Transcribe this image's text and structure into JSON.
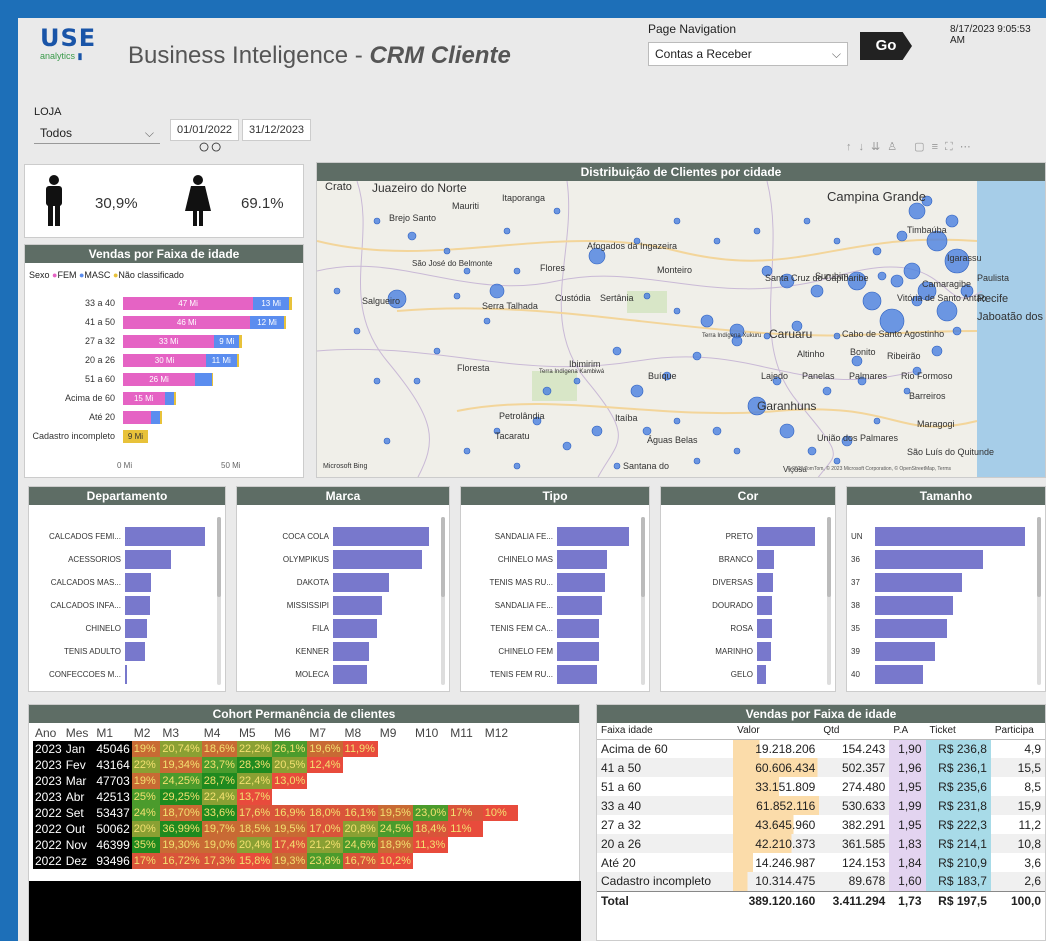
{
  "header": {
    "logo_main": "USE",
    "logo_sub": "analytics",
    "title_plain": "Business Inteligence - ",
    "title_bold": "CRM Cliente",
    "nav_label": "Page Navigation",
    "nav_value": "Contas a Receber",
    "go_label": "Go",
    "timestamp": "8/17/2023 9:05:53 AM"
  },
  "filters": {
    "loja_label": "LOJA",
    "loja_value": "Todos",
    "date_start": "01/01/2022",
    "date_end": "31/12/2023"
  },
  "gender": {
    "male_pct": "30,9%",
    "female_pct": "69.1%"
  },
  "map": {
    "title": "Distribuição de Clientes por cidade",
    "attribution": "Microsoft Bing",
    "copyright": "© 2023 TomTom, © 2023 Microsoft Corporation, © OpenStreetMap, Terms",
    "cities": [
      "Crato",
      "Juazeiro do Norte",
      "Itaporanga",
      "Mauriti",
      "Brejo Santo",
      "São José do Belmonte",
      "Flores",
      "Afogados da Ingazeira",
      "Monteiro",
      "Campina Grande",
      "Timbaúba",
      "Igarassu",
      "Paulista",
      "Surubim",
      "Camaragibe",
      "Santa Cruz do Capibaribe",
      "Vitória de Santo Antão",
      "Recife",
      "Jaboatão dos Guararapes",
      "Salgueiro",
      "Serra Talhada",
      "Custódia",
      "Sertânia",
      "Caruaru",
      "Cabo de Santo Agostinho",
      "Altinho",
      "Bonito",
      "Ribeirão",
      "Floresta",
      "Terra Indígena Kambiwá",
      "Ibimirim",
      "Buíque",
      "Lajedo",
      "Panelas",
      "Palmares",
      "Rio Formoso",
      "Barreiros",
      "Garanhuns",
      "Maragogi",
      "Petrolândia",
      "Itaíba",
      "Tacaratu",
      "Águas Belas",
      "União dos Palmares",
      "Santana do",
      "São Luís do Quitunde",
      "Viçosa",
      "Terra Indígena Xukuru"
    ]
  },
  "age_chart": {
    "title": "Vendas por Faixa de idade",
    "legend_label": "Sexo",
    "legend": [
      {
        "name": "FEM",
        "color": "#e563c4"
      },
      {
        "name": "MASC",
        "color": "#5b8def"
      },
      {
        "name": "Não classificado",
        "color": "#e8c23a"
      }
    ],
    "rows": [
      {
        "label": "33 a 40",
        "fem": 47,
        "masc": 13,
        "nc": 1,
        "fem_lbl": "47 Mi",
        "masc_lbl": "13 Mi"
      },
      {
        "label": "41 a 50",
        "fem": 46,
        "masc": 12,
        "nc": 1,
        "fem_lbl": "46 Mi",
        "masc_lbl": "12 Mi"
      },
      {
        "label": "27 a 32",
        "fem": 33,
        "masc": 9,
        "nc": 1,
        "fem_lbl": "33 Mi",
        "masc_lbl": "9 Mi"
      },
      {
        "label": "20 a 26",
        "fem": 30,
        "masc": 11,
        "nc": 1,
        "fem_lbl": "30 Mi",
        "masc_lbl": "11 Mi"
      },
      {
        "label": "51 a 60",
        "fem": 26,
        "masc": 6,
        "nc": 0.5,
        "fem_lbl": "26 Mi",
        "masc_lbl": ""
      },
      {
        "label": "Acima de 60",
        "fem": 15,
        "masc": 3.5,
        "nc": 0.5,
        "fem_lbl": "15 Mi",
        "masc_lbl": ""
      },
      {
        "label": "Até 20",
        "fem": 10,
        "masc": 3.5,
        "nc": 0.5,
        "fem_lbl": "",
        "masc_lbl": ""
      },
      {
        "label": "Cadastro incompleto",
        "fem": 0,
        "masc": 0,
        "nc": 9,
        "fem_lbl": "",
        "masc_lbl": "",
        "nc_lbl": "9 Mi"
      }
    ],
    "x_ticks": [
      "0 Mi",
      "50 Mi"
    ],
    "xmax": 65
  },
  "cat_charts": [
    {
      "title": "Departamento",
      "items": [
        {
          "label": "CALCADOS FEMI...",
          "v": 100
        },
        {
          "label": "ACESSORIOS",
          "v": 57
        },
        {
          "label": "CALCADOS MAS...",
          "v": 33
        },
        {
          "label": "CALCADOS INFA...",
          "v": 31
        },
        {
          "label": "CHINELO",
          "v": 28
        },
        {
          "label": "TENIS ADULTO",
          "v": 25
        },
        {
          "label": "CONFECCOES M...",
          "v": 2
        }
      ]
    },
    {
      "title": "Marca",
      "items": [
        {
          "label": "COCA COLA",
          "v": 100
        },
        {
          "label": "OLYMPIKUS",
          "v": 93
        },
        {
          "label": "DAKOTA",
          "v": 58
        },
        {
          "label": "MISSISSIPI",
          "v": 51
        },
        {
          "label": "FILA",
          "v": 46
        },
        {
          "label": "KENNER",
          "v": 37
        },
        {
          "label": "MOLECA",
          "v": 35
        }
      ]
    },
    {
      "title": "Tipo",
      "items": [
        {
          "label": "SANDALIA FE...",
          "v": 100
        },
        {
          "label": "CHINELO MAS",
          "v": 69
        },
        {
          "label": "TENIS MAS RU...",
          "v": 67
        },
        {
          "label": "SANDALIA FE...",
          "v": 63
        },
        {
          "label": "TENIS FEM CA...",
          "v": 59
        },
        {
          "label": "CHINELO FEM",
          "v": 58
        },
        {
          "label": "TENIS FEM RU...",
          "v": 56
        }
      ]
    },
    {
      "title": "Cor",
      "items": [
        {
          "label": "PRETO",
          "v": 100
        },
        {
          "label": "BRANCO",
          "v": 29
        },
        {
          "label": "DIVERSAS",
          "v": 27
        },
        {
          "label": "DOURADO",
          "v": 26
        },
        {
          "label": "ROSA",
          "v": 25
        },
        {
          "label": "MARINHO",
          "v": 24
        },
        {
          "label": "GELO",
          "v": 15
        }
      ]
    },
    {
      "title": "Tamanho",
      "items": [
        {
          "label": "UN",
          "v": 100
        },
        {
          "label": "36",
          "v": 72
        },
        {
          "label": "37",
          "v": 58
        },
        {
          "label": "38",
          "v": 52
        },
        {
          "label": "35",
          "v": 48
        },
        {
          "label": "39",
          "v": 40
        },
        {
          "label": "40",
          "v": 32
        }
      ]
    }
  ],
  "cohort": {
    "title": "Cohort Permanência de clientes",
    "headers": [
      "Ano",
      "Mes",
      "M1",
      "M2",
      "M3",
      "M4",
      "M5",
      "M6",
      "M7",
      "M8",
      "M9",
      "M10",
      "M11",
      "M12"
    ],
    "rows": [
      {
        "ano": "2023",
        "mes": "Jan",
        "m1": "45046",
        "cells": [
          "19%",
          "20,74%",
          "18,6%",
          "22,2%",
          "26,1%",
          "19,6%",
          "11,9%"
        ]
      },
      {
        "ano": "2023",
        "mes": "Fev",
        "m1": "43164",
        "cells": [
          "22%",
          "19,34%",
          "23,7%",
          "28,3%",
          "20,5%",
          "12,4%"
        ]
      },
      {
        "ano": "2023",
        "mes": "Mar",
        "m1": "47703",
        "cells": [
          "19%",
          "24,25%",
          "28,7%",
          "22,4%",
          "13,0%"
        ]
      },
      {
        "ano": "2023",
        "mes": "Abr",
        "m1": "42513",
        "cells": [
          "25%",
          "29,25%",
          "22,4%",
          "13,7%"
        ]
      },
      {
        "ano": "2022",
        "mes": "Set",
        "m1": "53437",
        "cells": [
          "24%",
          "18,70%",
          "33,6%",
          "17,6%",
          "16,9%",
          "18,0%",
          "16,1%",
          "19,5%",
          "23,0%",
          "17%",
          "10%"
        ]
      },
      {
        "ano": "2022",
        "mes": "Out",
        "m1": "50062",
        "cells": [
          "20%",
          "36,99%",
          "19,7%",
          "18,5%",
          "19,5%",
          "17,0%",
          "20,8%",
          "24,5%",
          "18,4%",
          "11%"
        ]
      },
      {
        "ano": "2022",
        "mes": "Nov",
        "m1": "46399",
        "cells": [
          "35%",
          "19,30%",
          "19,0%",
          "20,4%",
          "17,4%",
          "21,2%",
          "24,6%",
          "18,9%",
          "11,3%"
        ]
      },
      {
        "ano": "2022",
        "mes": "Dez",
        "m1": "93496",
        "cells": [
          "17%",
          "16,72%",
          "17,3%",
          "15,8%",
          "19,3%",
          "23,8%",
          "16,7%",
          "10,2%"
        ]
      }
    ]
  },
  "sales_table": {
    "title": "Vendas por Faixa de idade",
    "headers": [
      "Faixa idade",
      "Valor",
      "Qtd",
      "P.A",
      "Ticket",
      "Participa"
    ],
    "rows": [
      {
        "faixa": "Acima de 60",
        "valor": "19.218.206",
        "qtd": "154.243",
        "pa": "1,90",
        "ticket": "R$ 236,8",
        "part": "4,9"
      },
      {
        "faixa": "41 a 50",
        "valor": "60.606.434",
        "qtd": "502.357",
        "pa": "1,96",
        "ticket": "R$ 236,1",
        "part": "15,5"
      },
      {
        "faixa": "51 a 60",
        "valor": "33.151.809",
        "qtd": "274.480",
        "pa": "1,95",
        "ticket": "R$ 235,6",
        "part": "8,5"
      },
      {
        "faixa": "33 a 40",
        "valor": "61.852.116",
        "qtd": "530.633",
        "pa": "1,99",
        "ticket": "R$ 231,8",
        "part": "15,9"
      },
      {
        "faixa": "27 a 32",
        "valor": "43.645.960",
        "qtd": "382.291",
        "pa": "1,95",
        "ticket": "R$ 222,3",
        "part": "11,2"
      },
      {
        "faixa": "20 a 26",
        "valor": "42.210.373",
        "qtd": "361.585",
        "pa": "1,83",
        "ticket": "R$ 214,1",
        "part": "10,8"
      },
      {
        "faixa": "Até 20",
        "valor": "14.246.987",
        "qtd": "124.153",
        "pa": "1,84",
        "ticket": "R$ 210,9",
        "part": "3,6"
      },
      {
        "faixa": "Cadastro incompleto",
        "valor": "10.314.475",
        "qtd": "89.678",
        "pa": "1,60",
        "ticket": "R$ 183,7",
        "part": "2,6"
      }
    ],
    "total": {
      "faixa": "Total",
      "valor": "389.120.160",
      "qtd": "3.411.294",
      "pa": "1,73",
      "ticket": "R$ 197,5",
      "part": "100,0"
    }
  }
}
